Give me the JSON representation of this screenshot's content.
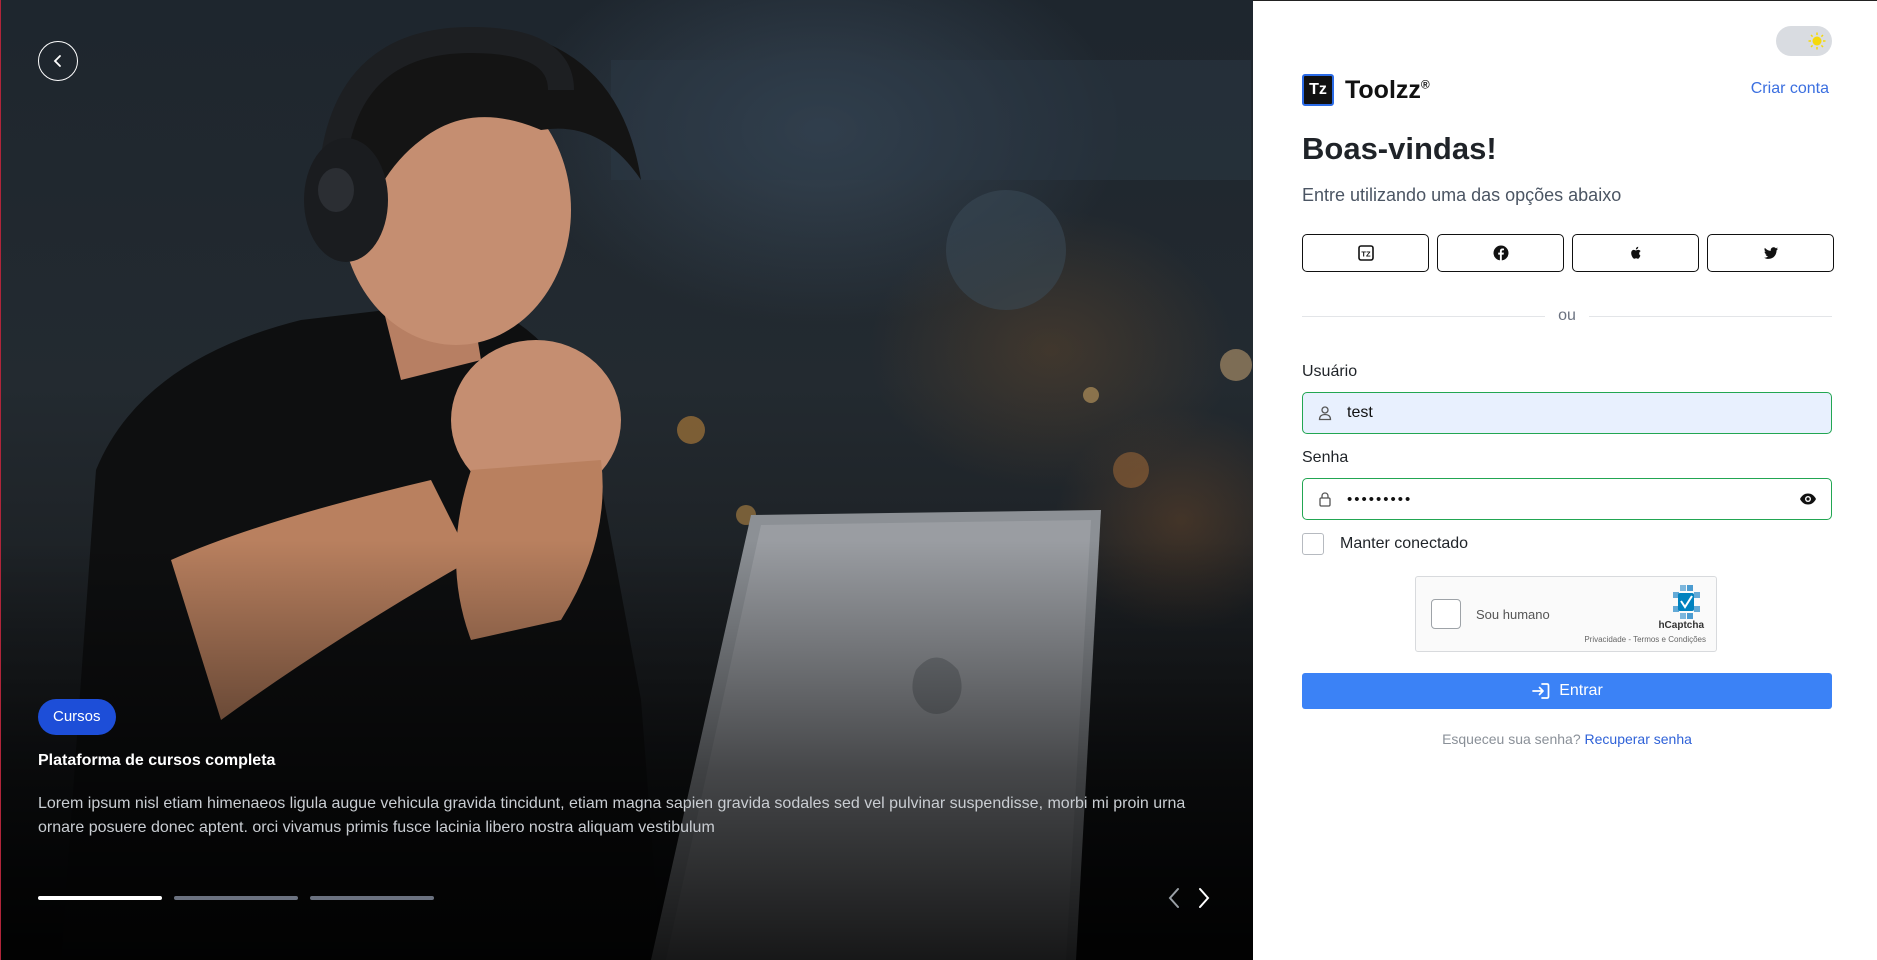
{
  "hero": {
    "tag": "Cursos",
    "title": "Plataforma de cursos completa",
    "description": "Lorem ipsum nisl etiam himenaeos ligula augue vehicula gravida tincidunt, etiam magna sapien gravida sodales sed vel pulvinar suspendisse, morbi mi proin urna ornare posuere donec aptent. orci vivamus primis fusce lacinia libero nostra aliquam vestibulum",
    "slides_total": 3,
    "active_slide": 1
  },
  "brand": {
    "logo_mark": "Tz",
    "name": "Toolzz",
    "trademark": "®"
  },
  "header": {
    "create_account": "Criar conta"
  },
  "login": {
    "welcome": "Boas-vindas!",
    "subtitle": "Entre utilizando uma das opções abaixo",
    "social_icons": [
      "toolzz-icon",
      "facebook-icon",
      "apple-icon",
      "twitter-icon"
    ],
    "divider": "ou",
    "username_label": "Usuário",
    "username_value": "test",
    "password_label": "Senha",
    "password_value": "•••••••••",
    "remember_label": "Manter conectado",
    "captcha_label": "Sou humano",
    "captcha_brand": "hCaptcha",
    "captcha_terms": "Privacidade - Termos e Condições",
    "submit_label": "Entrar",
    "forgot_text": "Esqueceu sua senha?",
    "forgot_link": "Recuperar senha"
  },
  "colors": {
    "accent": "#3b82f6",
    "tag_bg": "#1d4ed8",
    "field_valid_border": "#22a652",
    "link": "#3b6fe0"
  }
}
